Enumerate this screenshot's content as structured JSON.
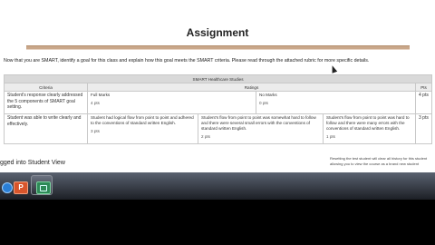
{
  "page": {
    "top_text": "",
    "heading": "Assignment",
    "intro": "Now that you are SMART, identify a goal for this class and explain how this goal meets the SMART criteria. Please read through the attached rubric for more specific details."
  },
  "rubric": {
    "title": "SMART Healthcare Studies",
    "headers": {
      "criteria": "Criteria",
      "ratings": "Ratings",
      "pts": "Pts"
    },
    "rows": [
      {
        "criterion": "Student's response clearly addressed the 5 components of SMART goal setting.",
        "ratings": [
          {
            "title": "Full Marks",
            "pts": "4 pts"
          },
          {
            "title": "No Marks",
            "pts": "0 pts"
          }
        ],
        "points": "4 pts"
      },
      {
        "criterion": "Student was able to write clearly and effectively.",
        "ratings": [
          {
            "title": "Student had logical flow from point to point and adhered to the conventions of standard written English.",
            "pts": "3 pts"
          },
          {
            "title": "Student's flow from point to point was somewhat hard to follow and there were several small errors with the conventions of standard written English.",
            "pts": "2 pts"
          },
          {
            "title": "Student's flow from point to point was hard to follow and there were many errors with the conventions of standard written English.",
            "pts": "1 pts"
          }
        ],
        "points": "3 pts"
      }
    ]
  },
  "status": {
    "left": "gged into Student View",
    "right_line1": "Resetting the test student will clear all history for this student",
    "right_line2": "allowing you to view the course as a brand new student"
  },
  "taskbar": {
    "items": [
      "internet-explorer",
      "powerpoint",
      "camtasia"
    ],
    "colors": {
      "taskbar": "#2b2f36",
      "ppt": "#d8552b",
      "ie": "#2a7fd6"
    }
  },
  "colors": {
    "rule": "#c9a78a",
    "table_header": "#d9d9d9"
  }
}
